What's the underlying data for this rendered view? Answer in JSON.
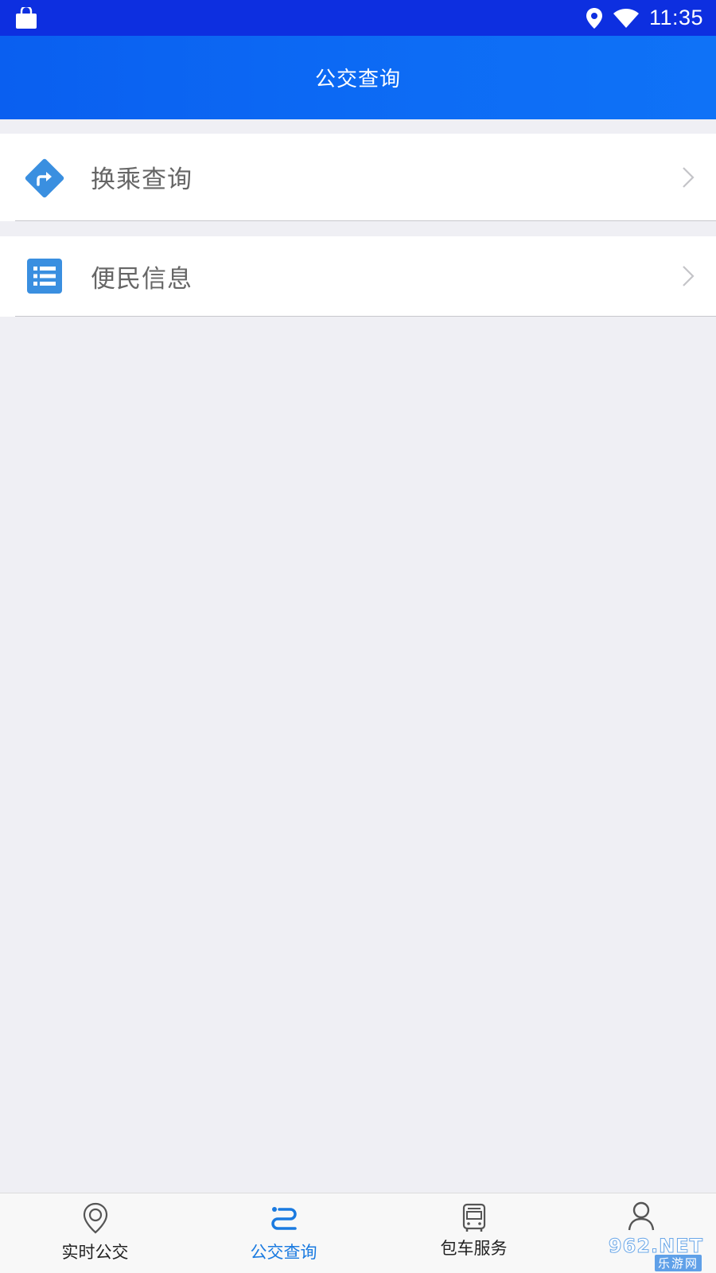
{
  "status_bar": {
    "time": "11:35",
    "left_icon": "shopping-bag-icon",
    "right_icons": [
      "location-pin-icon",
      "wifi-icon"
    ]
  },
  "header": {
    "title": "公交查询"
  },
  "menu": [
    {
      "label": "换乘查询",
      "icon": "turn-right-diamond-icon",
      "chevron": "chevron-right-icon"
    },
    {
      "label": "便民信息",
      "icon": "list-icon",
      "chevron": "chevron-right-icon"
    }
  ],
  "tabs": [
    {
      "label": "实时公交",
      "icon": "location-pin-icon",
      "active": false
    },
    {
      "label": "公交查询",
      "icon": "route-icon",
      "active": true
    },
    {
      "label": "包车服务",
      "icon": "bus-icon",
      "active": false
    },
    {
      "label": "",
      "icon": "user-icon",
      "active": false
    }
  ],
  "watermark": {
    "top": "962.NET",
    "bottom": "乐游网"
  },
  "colors": {
    "status_bar": "#0d2fe0",
    "header": "#0d6cf5",
    "accent": "#1a7ae0",
    "icon_blue": "#3a8fe0",
    "background": "#efeff4"
  }
}
